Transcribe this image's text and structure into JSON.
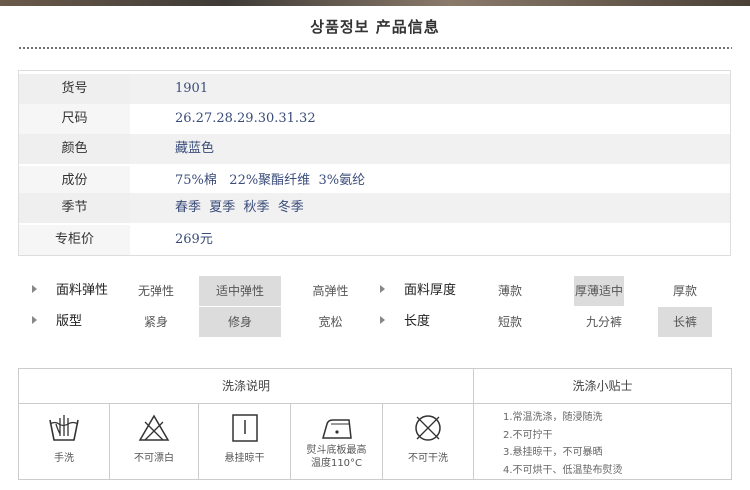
{
  "header": {
    "title": "상품정보   产品信息"
  },
  "info": [
    {
      "label": "货号",
      "value": "1901"
    },
    {
      "label": "尺码",
      "value": "26.27.28.29.30.31.32"
    },
    {
      "label": "颜色",
      "value": "藏蓝色"
    },
    {
      "label": "成份",
      "value": "75%棉   22%聚酯纤维  3%氨纶"
    },
    {
      "label": "季节",
      "value": "春季  夏季  秋季  冬季"
    },
    {
      "label": "专柜价",
      "value": "269元"
    }
  ],
  "attributes": {
    "elasticity": {
      "title": "面料弹性",
      "options": [
        "无弹性",
        "适中弹性",
        "高弹性"
      ],
      "selected": "适中弹性"
    },
    "thickness": {
      "title": "面料厚度",
      "options": [
        "薄款",
        "厚薄适中",
        "厚款"
      ],
      "selected": "厚薄适中"
    },
    "fit": {
      "title": "版型",
      "options": [
        "紧身",
        "修身",
        "宽松"
      ],
      "selected": "修身"
    },
    "length": {
      "title": "长度",
      "options": [
        "短款",
        "九分裤",
        "长裤"
      ],
      "selected": "长裤"
    }
  },
  "wash": {
    "heading": "洗涤说明",
    "tips_heading": "洗涤小贴士",
    "symbols": [
      {
        "icon": "hand-wash-icon",
        "label": "手洗"
      },
      {
        "icon": "no-bleach-icon",
        "label": "不可漂白"
      },
      {
        "icon": "hang-dry-icon",
        "label": "悬挂晾干"
      },
      {
        "icon": "iron-icon",
        "label": "熨斗底板最高",
        "label2": "温度110°C"
      },
      {
        "icon": "no-dry-clean-icon",
        "label": "不可干洗"
      }
    ],
    "tips": [
      "1.常温洗涤，随浸随洗",
      "2.不可拧干",
      "3.悬挂晾干，不可暴晒",
      "4.不可烘干、低温垫布熨烫"
    ]
  }
}
